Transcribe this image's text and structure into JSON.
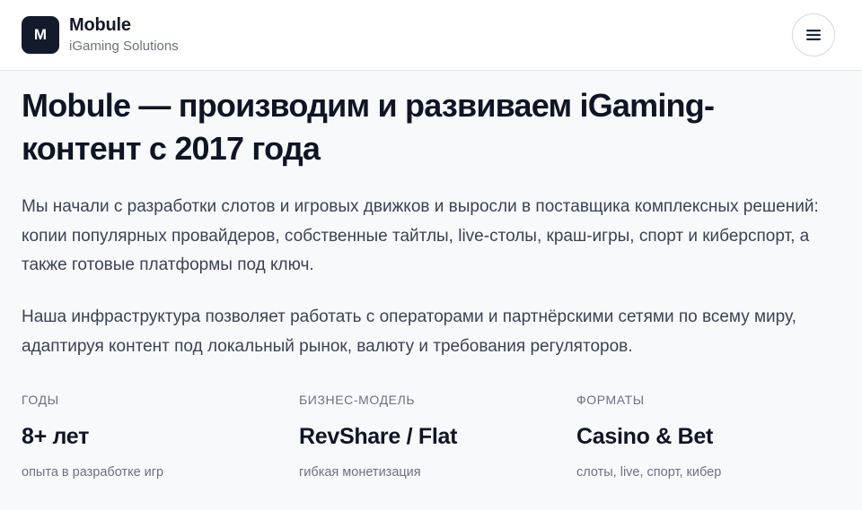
{
  "header": {
    "logo_letter": "M",
    "brand_name": "Mobule",
    "brand_subtitle": "iGaming Solutions",
    "menu_icon": "hamburger-menu-icon"
  },
  "main": {
    "title": "Mobule — производим и развиваем iGaming-контент с 2017 года",
    "paragraph_1": "Мы начали с разработки слотов и игровых движков и выросли в поставщика комплексных решений: копии популярных провайдеров, собственные тайтлы, live-столы, краш-игры, спорт и киберспорт, а также готовые платформы под ключ.",
    "paragraph_2": "Наша инфраструктура позволяет работать с операторами и партнёрскими сетями по всему миру, адаптируя контент под локальный рынок, валюту и требования регуляторов."
  },
  "stats": [
    {
      "label": "Годы",
      "value": "8+ лет",
      "note": "опыта в разработке игр"
    },
    {
      "label": "Бизнес-модель",
      "value": "RevShare / Flat",
      "note": "гибкая монетизация"
    },
    {
      "label": "Форматы",
      "value": "Casino & Bet",
      "note": "слоты, live, спорт, кибер"
    }
  ],
  "colors": {
    "logo_bg": "#121a2b",
    "background": "#f8f9fb",
    "text_primary": "#0f1524",
    "text_muted": "#6b7280"
  }
}
